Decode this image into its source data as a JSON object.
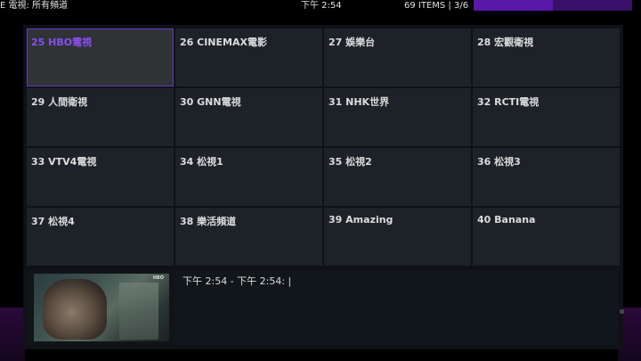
{
  "topbar": {
    "title": "E 電視: 所有頻道",
    "time": "下午 2:54",
    "count": "69 ITEMS | 3/6",
    "progress_fraction": 0.5
  },
  "channels": [
    {
      "label": "25  HBO電視",
      "selected": true
    },
    {
      "label": "26  CINEMAX電影"
    },
    {
      "label": "27  娛樂台"
    },
    {
      "label": "28  宏觀衛視"
    },
    {
      "label": "29  人間衛視"
    },
    {
      "label": "30  GNN電視"
    },
    {
      "label": "31  NHK世界"
    },
    {
      "label": "32  RCTI電視"
    },
    {
      "label": "33  VTV4電視"
    },
    {
      "label": "34  松視1"
    },
    {
      "label": "35  松視2"
    },
    {
      "label": "36  松視3"
    },
    {
      "label": "37  松視4"
    },
    {
      "label": "38  樂活頻道"
    },
    {
      "label": "39  Amazing"
    },
    {
      "label": "40  Banana"
    }
  ],
  "preview": {
    "logo": "HBO"
  },
  "epg": {
    "text": "下午 2:54 - 下午 2:54:   |"
  },
  "colors": {
    "accent": "#6a38c8",
    "selected_text": "#8a4ef0",
    "tile_bg": "#1d2228",
    "panel_bg": "#0e1216"
  }
}
